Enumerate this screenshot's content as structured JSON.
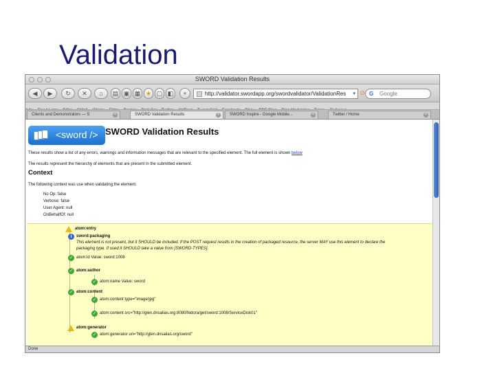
{
  "slide": {
    "title": "Validation"
  },
  "browser": {
    "window_title": "SWORD Validation Results",
    "url": "http://validator.swordapp.org/swordvalidator/ValidationRes",
    "search_placeholder": "Google",
    "bookmarks": [
      "Ade",
      "Read Later",
      "DCal",
      "GMail",
      "GNote",
      "Ebba",
      "Boston",
      "DoK Cal",
      "Twitter",
      "YelBeet",
      "Tweet Grid",
      "Facebook",
      "Bit.ly",
      "RRF Blog",
      "Bing Modulator",
      "Trains",
      "Delicious"
    ],
    "tabs": [
      {
        "label": "Clients and Demonstrators — S"
      },
      {
        "label": "SWORD Validation Results"
      },
      {
        "label": "SWORD Inspire - Google Mobile..."
      },
      {
        "label": "Twitter / Home"
      }
    ],
    "status_text": "Done"
  },
  "page": {
    "logo_text": "<sword />",
    "heading": "SWORD Validation Results",
    "intro_text": "These results show a list of any errors, warnings and information messages that are relevant to the specified element. The full element is shown",
    "intro_link": "below",
    "hierarchy_text": "The results represent the hierarchy of elements that are present in the submitted element.",
    "context_heading": "Context",
    "context_intro": "The following context was use when validating the element.",
    "context_items": [
      "No Op: false",
      "Verbose: false",
      "User Agent: null",
      "OnBehalfOf: null"
    ],
    "results": {
      "entry": "atom:entry",
      "packaging": "sword:packaging",
      "packaging_msg_1": "This element is not present, but it SHOULD be included. If the POST request results in the creation of packaged resource, the server MAY use this element to declare the",
      "packaging_msg_2": "packaging type. If used it SHOULD take a value from [SWORD-TYPES].",
      "id": "atom:id   Value: sword:1008",
      "author": "atom:author",
      "author_name": "atom:name   Value: sword",
      "content": "atom:content",
      "content_type": "atom:content type=\"image/jpg\"",
      "content_src": "atom:content src=\"http://glen.dnsalias.org:8080/fedora/get/sword:1008/ServiceDisk01\"",
      "generator": "atom:generator",
      "generator_uri": "atom:generator uri=\"http://glen.dnsalias.org/sword\""
    }
  },
  "colors": {
    "results_bg": "#ffffc6",
    "ok": "#3fa830",
    "info": "#3a63c9",
    "warn": "#e8b912",
    "logo": "#1b6fd0"
  }
}
